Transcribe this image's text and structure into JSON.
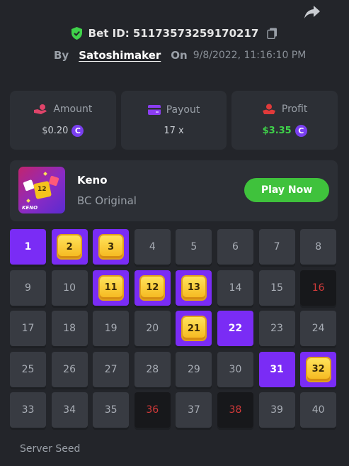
{
  "bet": {
    "label": "Bet ID: 51173573259170217",
    "by_label": "By",
    "author": "Satoshimaker",
    "on_label": "On",
    "date": "9/8/2022, 11:16:10 PM"
  },
  "stats": {
    "amount": {
      "label": "Amount",
      "value": "$0.20",
      "icon": "hand-coin-icon"
    },
    "payout": {
      "label": "Payout",
      "value": "17 x",
      "icon": "wallet-icon"
    },
    "profit": {
      "label": "Profit",
      "value": "$3.35",
      "icon": "profit-icon"
    }
  },
  "colors": {
    "background": "#23252a",
    "card": "#2c2f35",
    "accent_purple": "#7a2cf5",
    "play_green": "#3fc23c",
    "profit_green": "#3fd24a",
    "miss_red": "#d23a3a"
  },
  "game": {
    "name": "Keno",
    "subtitle": "BC Original",
    "play_label": "Play Now",
    "thumb_label": "KENO",
    "thumb_die_label": "12"
  },
  "coin_symbol": "C",
  "keno": {
    "cells": [
      {
        "n": "1",
        "s": "hit"
      },
      {
        "n": "2",
        "s": "gem"
      },
      {
        "n": "3",
        "s": "gem"
      },
      {
        "n": "4",
        "s": "normal"
      },
      {
        "n": "5",
        "s": "normal"
      },
      {
        "n": "6",
        "s": "normal"
      },
      {
        "n": "7",
        "s": "normal"
      },
      {
        "n": "8",
        "s": "normal"
      },
      {
        "n": "9",
        "s": "normal"
      },
      {
        "n": "10",
        "s": "normal"
      },
      {
        "n": "11",
        "s": "gem"
      },
      {
        "n": "12",
        "s": "gem"
      },
      {
        "n": "13",
        "s": "gem"
      },
      {
        "n": "14",
        "s": "normal"
      },
      {
        "n": "15",
        "s": "normal"
      },
      {
        "n": "16",
        "s": "miss"
      },
      {
        "n": "17",
        "s": "normal"
      },
      {
        "n": "18",
        "s": "normal"
      },
      {
        "n": "19",
        "s": "normal"
      },
      {
        "n": "20",
        "s": "normal"
      },
      {
        "n": "21",
        "s": "gem"
      },
      {
        "n": "22",
        "s": "hit"
      },
      {
        "n": "23",
        "s": "normal"
      },
      {
        "n": "24",
        "s": "normal"
      },
      {
        "n": "25",
        "s": "normal"
      },
      {
        "n": "26",
        "s": "normal"
      },
      {
        "n": "27",
        "s": "normal"
      },
      {
        "n": "28",
        "s": "normal"
      },
      {
        "n": "29",
        "s": "normal"
      },
      {
        "n": "30",
        "s": "normal"
      },
      {
        "n": "31",
        "s": "hit"
      },
      {
        "n": "32",
        "s": "gem"
      },
      {
        "n": "33",
        "s": "normal"
      },
      {
        "n": "34",
        "s": "normal"
      },
      {
        "n": "35",
        "s": "normal"
      },
      {
        "n": "36",
        "s": "miss"
      },
      {
        "n": "37",
        "s": "normal"
      },
      {
        "n": "38",
        "s": "miss"
      },
      {
        "n": "39",
        "s": "normal"
      },
      {
        "n": "40",
        "s": "normal"
      }
    ]
  },
  "server_seed_label": "Server Seed"
}
